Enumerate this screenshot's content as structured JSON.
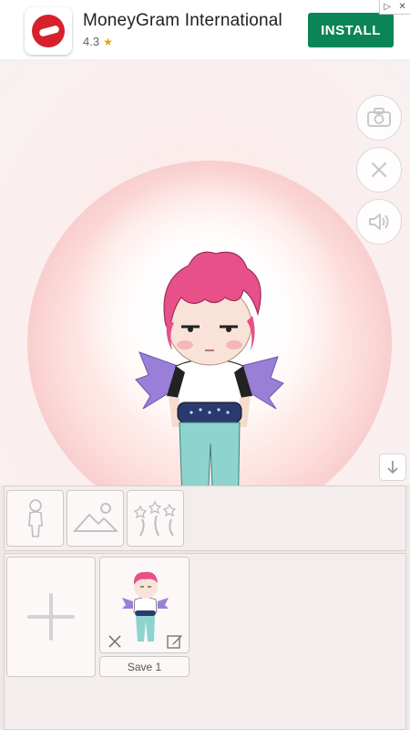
{
  "ad": {
    "app_name": "MoneyGram International",
    "rating": "4.3",
    "rating_icon": "star-icon",
    "install_label": "INSTALL",
    "accent_color": "#0b8457",
    "logo_color": "#d6202b"
  },
  "stage": {
    "buttons": [
      {
        "icon": "camera-icon"
      },
      {
        "icon": "close-icon"
      },
      {
        "icon": "speaker-icon"
      }
    ],
    "down_icon": "arrow-down-icon",
    "character": {
      "hair_color": "#e8508a",
      "shirt_color": "#ffffff",
      "pants_color": "#8fd3cf",
      "wing_color": "#9a7fd8",
      "belt_color": "#2a3a6e"
    }
  },
  "panel": {
    "tabs": [
      {
        "icon": "body-icon"
      },
      {
        "icon": "background-icon"
      },
      {
        "icon": "effects-icon"
      }
    ],
    "add_icon": "plus-icon",
    "save_slot": {
      "label": "Save 1",
      "delete_icon": "close-icon",
      "edit_icon": "edit-icon"
    }
  }
}
